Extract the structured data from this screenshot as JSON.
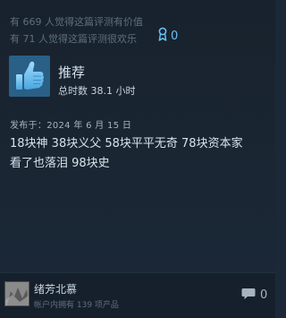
{
  "helpful": {
    "useful_text": "有 669 人觉得这篇评测有价值",
    "funny_text": "有 71 人觉得这篇评测很欢乐"
  },
  "award": {
    "icon": "award-ribbon-icon",
    "count": "0",
    "color": "#66c0f4"
  },
  "recommendation": {
    "icon": "thumbs-up-icon",
    "label": "推荐",
    "hours": "总时数 38.1 小时"
  },
  "review": {
    "posted": "发布于：2024 年 6 月 15 日",
    "text": "18块神 38块义父 58块平平无奇 78块资本家\n看了也落泪 98块史"
  },
  "author": {
    "name": "绪芳北慕",
    "products": "帐户内拥有 139 项产品"
  },
  "comments": {
    "icon": "comment-bubble-icon",
    "count": "0"
  },
  "colors": {
    "background": "#1b2838",
    "thumb_bg": "#2a5f86",
    "accent": "#66c0f4"
  }
}
